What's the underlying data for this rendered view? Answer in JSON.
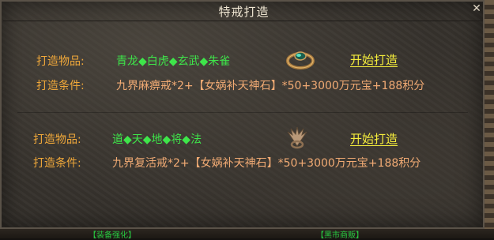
{
  "title": "特戒打造",
  "close_icon": "close-icon",
  "recipes": [
    {
      "item_label": "打造物品:",
      "items": "青龙◆白虎◆玄武◆朱雀",
      "cond_label": "打造条件:",
      "cond": "九界麻痹戒*2+【女娲补天神石】*50+3000万元宝+188积分",
      "button": "开始打造",
      "icon": "jade-ring-icon"
    },
    {
      "item_label": "打造物品:",
      "items": "道◆天◆地◆将◆法",
      "cond_label": "打造条件:",
      "cond": "九界复活戒*2+【女娲补天神石】*50+3000万元宝+188积分",
      "button": "开始打造",
      "icon": "winged-ring-icon"
    }
  ],
  "bottom_left_fragment": "【装备强化】",
  "bottom_right_fragment": "【黑市商贩】",
  "colors": {
    "label": "#f0a83a",
    "items": "#3ee64a",
    "condition": "#f2ab74",
    "button": "#f6ee3c"
  }
}
